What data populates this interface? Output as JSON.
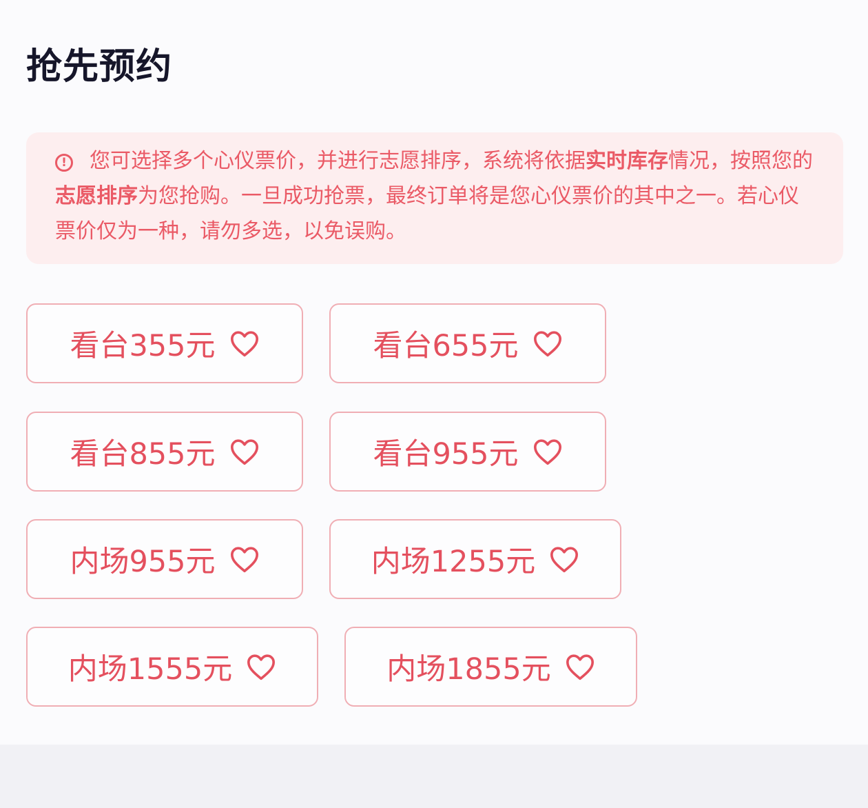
{
  "page": {
    "title": "抢先预约"
  },
  "notice": {
    "icon": "exclamation-circle-icon",
    "text_before": "您可选择多个心仪票价，并进行志愿排序，系统将依据",
    "emphasis_1": "实时库存",
    "text_middle": "情况，按照您的",
    "emphasis_2": "志愿排序",
    "text_after": "为您抢购。一旦成功抢票，最终订单将是您心仪票价的其中之一。若心仪票价仅为一种，请勿多选，以免误购。"
  },
  "ticket_options": [
    {
      "label": "看台355元",
      "icon": "heart-icon"
    },
    {
      "label": "看台655元",
      "icon": "heart-icon"
    },
    {
      "label": "看台855元",
      "icon": "heart-icon"
    },
    {
      "label": "看台955元",
      "icon": "heart-icon"
    },
    {
      "label": "内场955元",
      "icon": "heart-icon"
    },
    {
      "label": "内场1255元",
      "icon": "heart-icon"
    },
    {
      "label": "内场1555元",
      "icon": "heart-icon"
    },
    {
      "label": "内场1855元",
      "icon": "heart-icon"
    }
  ],
  "colors": {
    "accent": "#e4505e",
    "notice_background": "#fdeeef",
    "option_border": "#f0aeb4",
    "title": "#16162a"
  }
}
